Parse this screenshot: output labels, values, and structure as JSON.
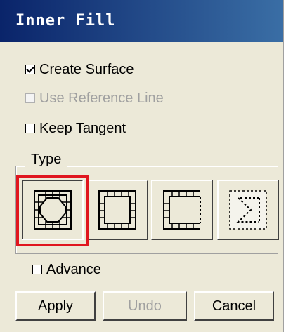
{
  "window": {
    "title": "Inner Fill"
  },
  "options": {
    "create_surface": {
      "label": "Create Surface",
      "checked": true,
      "enabled": true
    },
    "use_reference_line": {
      "label": "Use Reference Line",
      "checked": false,
      "enabled": false
    },
    "keep_tangent": {
      "label": "Keep Tangent",
      "checked": false,
      "enabled": true
    }
  },
  "type_group": {
    "label": "Type",
    "selected_index": 0,
    "buttons": [
      {
        "icon": "inner-fill-grid-circle-icon"
      },
      {
        "icon": "inner-fill-grid-border-icon"
      },
      {
        "icon": "inner-fill-open-border-icon"
      },
      {
        "icon": "inner-fill-dashed-sigma-icon"
      }
    ]
  },
  "advance": {
    "label": "Advance",
    "checked": false
  },
  "actions": {
    "apply": "Apply",
    "undo": "Undo",
    "cancel": "Cancel"
  },
  "colors": {
    "highlight": "#e0161f",
    "titlebar": "#0a246a"
  }
}
